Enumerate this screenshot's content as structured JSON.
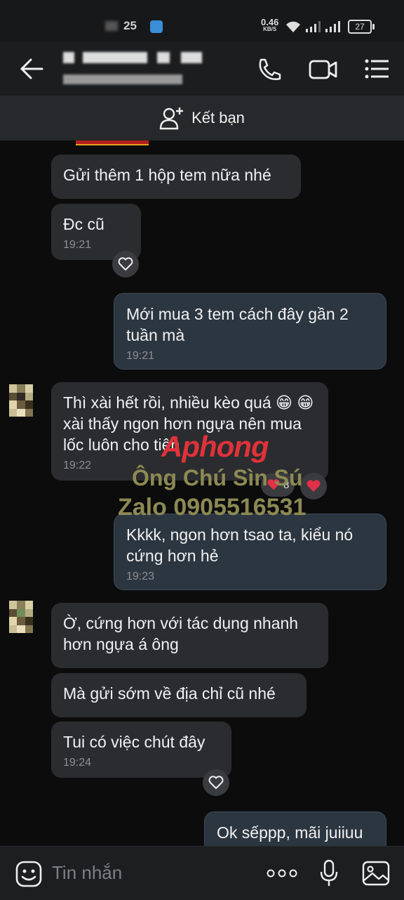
{
  "status_bar": {
    "time_visible": "25",
    "net_speed": "0.46",
    "net_unit": "KB/S",
    "battery": "27"
  },
  "header": {
    "actions": [
      "call-icon",
      "video-call-icon",
      "menu-icon"
    ]
  },
  "friend_bar": {
    "label": "Kết bạn"
  },
  "messages": [
    {
      "dir": "in",
      "text": "Gửi thêm 1 hộp tem nữa nhé",
      "time": ""
    },
    {
      "dir": "in",
      "text": "Đc cũ",
      "time": "19:21"
    },
    {
      "dir": "out",
      "text": "Mới mua 3 tem cách đây gần 2 tuần mà",
      "time": "19:21"
    },
    {
      "dir": "in",
      "text": "Thì xài hết rồi, nhiều kèo quá 😁 😁 xài thấy ngon hơn ngựa nên mua lốc luôn cho tiện",
      "time": "19:22",
      "reaction_count": "8"
    },
    {
      "dir": "out",
      "text": "Kkkk, ngon hơn tsao ta, kiểu nó cứng hơn hẻ",
      "time": "19:23"
    },
    {
      "dir": "in",
      "text": "Ờ, cứng hơn với tác dụng nhanh hơn ngựa á ông",
      "time": ""
    },
    {
      "dir": "in",
      "text": "Mà gửi sớm về địa chỉ cũ nhé",
      "time": ""
    },
    {
      "dir": "in",
      "text": "Tui có việc chút đây",
      "time": "19:24"
    },
    {
      "dir": "out",
      "text": "Ok sếppp, mãi juiiuu",
      "time": ""
    }
  ],
  "watermark": {
    "brand": "Aphong",
    "line1": "Ông Chú Sìn Sú",
    "line2": "Zalo 0905516531"
  },
  "composer": {
    "placeholder": "Tin nhắn"
  }
}
